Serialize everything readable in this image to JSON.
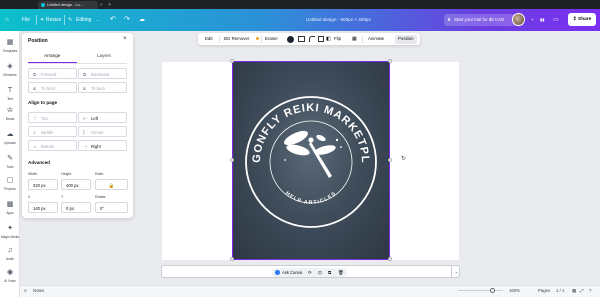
{
  "browser": {
    "tab_title": "Untitled design - Lo...",
    "close_glyph": "×",
    "new_tab_glyph": "+"
  },
  "header": {
    "home_glyph": "⌂",
    "file": "File",
    "resize": "Resize",
    "editing": "Editing",
    "undo_glyph": "↶",
    "redo_glyph": "↷",
    "doc_title": "Untitled design - 600px × 400px",
    "trial": "Start your trial for $0 CAD",
    "analytics_glyph": "▮▮",
    "comment_glyph": "▭",
    "share": "Share"
  },
  "rail": [
    {
      "label": "Templates",
      "glyph": "▦"
    },
    {
      "label": "Elements",
      "glyph": "◈"
    },
    {
      "label": "Text",
      "glyph": "T"
    },
    {
      "label": "Brand",
      "glyph": "♔"
    },
    {
      "label": "Uploads",
      "glyph": "☁"
    },
    {
      "label": "Tools",
      "glyph": "✎"
    },
    {
      "label": "Projects",
      "glyph": "▢"
    },
    {
      "label": "Apps",
      "glyph": "▩"
    },
    {
      "label": "Magic Media",
      "glyph": "✦"
    },
    {
      "label": "Audio",
      "glyph": "♫"
    },
    {
      "label": "AI Voice",
      "glyph": "◉"
    }
  ],
  "panel": {
    "title": "Position",
    "close_glyph": "×",
    "tab_arrange": "Arrange",
    "tab_layers": "Layers",
    "forward": "Forward",
    "backward": "Backward",
    "to_front": "To front",
    "to_back": "To back",
    "align_heading": "Align to page",
    "top": "Top",
    "left": "Left",
    "middle": "Middle",
    "center": "Center",
    "bottom": "Bottom",
    "right": "Right",
    "advanced_heading": "Advanced",
    "width_label": "Width",
    "height_label": "Height",
    "ratio_label": "Ratio",
    "width_value": "320 px",
    "height_value": "400 px",
    "x_label": "X",
    "y_label": "Y",
    "rotate_label": "Rotate",
    "x_value": "140 px",
    "y_value": "0 px",
    "rotate_value": "0°",
    "lock_glyph": "🔒"
  },
  "toolbar": {
    "edit": "Edit",
    "bg_remover": "BG Remover",
    "eraser": "Eraser",
    "flip": "Flip",
    "animate": "Animate",
    "position": "Position"
  },
  "artwork": {
    "arc_top": "DRAGONFLY REIKI MARKETPLACE",
    "arc_bottom": "HELP ARTICLES"
  },
  "bottom": {
    "ask_canva": "Ask Canva",
    "notes": "Notes",
    "zoom": "160%",
    "pages": "Pages",
    "page_count": "1 / 1"
  }
}
